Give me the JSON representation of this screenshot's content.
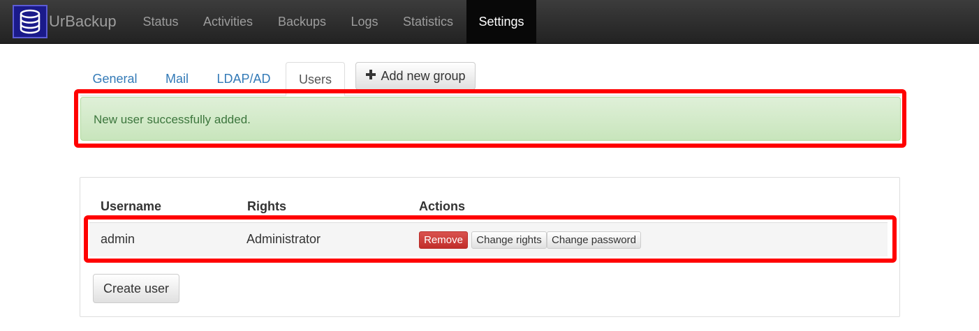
{
  "app": {
    "brand_name": "UrBackup",
    "brand_color": "#1a1a8a"
  },
  "nav": {
    "items": [
      {
        "label": "Status",
        "active": false
      },
      {
        "label": "Activities",
        "active": false
      },
      {
        "label": "Backups",
        "active": false
      },
      {
        "label": "Logs",
        "active": false
      },
      {
        "label": "Statistics",
        "active": false
      },
      {
        "label": "Settings",
        "active": true
      }
    ]
  },
  "tabs": {
    "items": [
      {
        "label": "General",
        "active": false
      },
      {
        "label": "Mail",
        "active": false
      },
      {
        "label": "LDAP/AD",
        "active": false
      },
      {
        "label": "Users",
        "active": true
      }
    ],
    "add_group_label": "Add new group",
    "add_group_icon": "plus-icon"
  },
  "alert": {
    "message": "New user successfully added.",
    "type": "success",
    "color": "#3c763d"
  },
  "users_table": {
    "headers": [
      "Username",
      "Rights",
      "Actions"
    ],
    "rows": [
      {
        "username": "admin",
        "rights": "Administrator",
        "actions": {
          "remove": "Remove",
          "change_rights": "Change rights",
          "change_password": "Change password"
        }
      }
    ],
    "create_label": "Create user"
  },
  "colors": {
    "highlight": "#ff0000",
    "danger": "#d9534f",
    "link": "#337ab7"
  }
}
